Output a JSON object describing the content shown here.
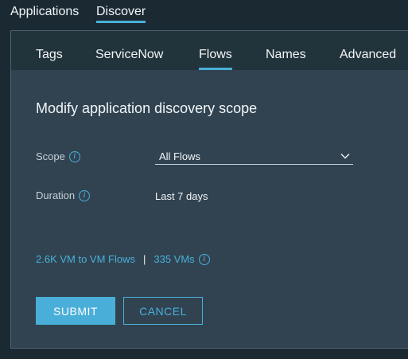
{
  "top_nav": {
    "tabs": [
      {
        "label": "Applications",
        "active": false
      },
      {
        "label": "Discover",
        "active": true
      }
    ]
  },
  "sub_nav": {
    "tabs": [
      {
        "label": "Tags",
        "active": false
      },
      {
        "label": "ServiceNow",
        "active": false
      },
      {
        "label": "Flows",
        "active": true
      },
      {
        "label": "Names",
        "active": false
      },
      {
        "label": "Advanced",
        "active": false
      }
    ]
  },
  "form": {
    "heading": "Modify application discovery scope",
    "scope_label": "Scope",
    "scope_value": "All Flows",
    "duration_label": "Duration",
    "duration_value": "Last 7 days",
    "info_glyph": "i"
  },
  "stats": {
    "flows_link": "2.6K VM to VM Flows",
    "separator": "|",
    "vms_link": "335 VMs"
  },
  "actions": {
    "submit_label": "SUBMIT",
    "cancel_label": "CANCEL"
  },
  "colors": {
    "background": "#1b2a32",
    "card": "#314351",
    "accent": "#49afd9"
  }
}
